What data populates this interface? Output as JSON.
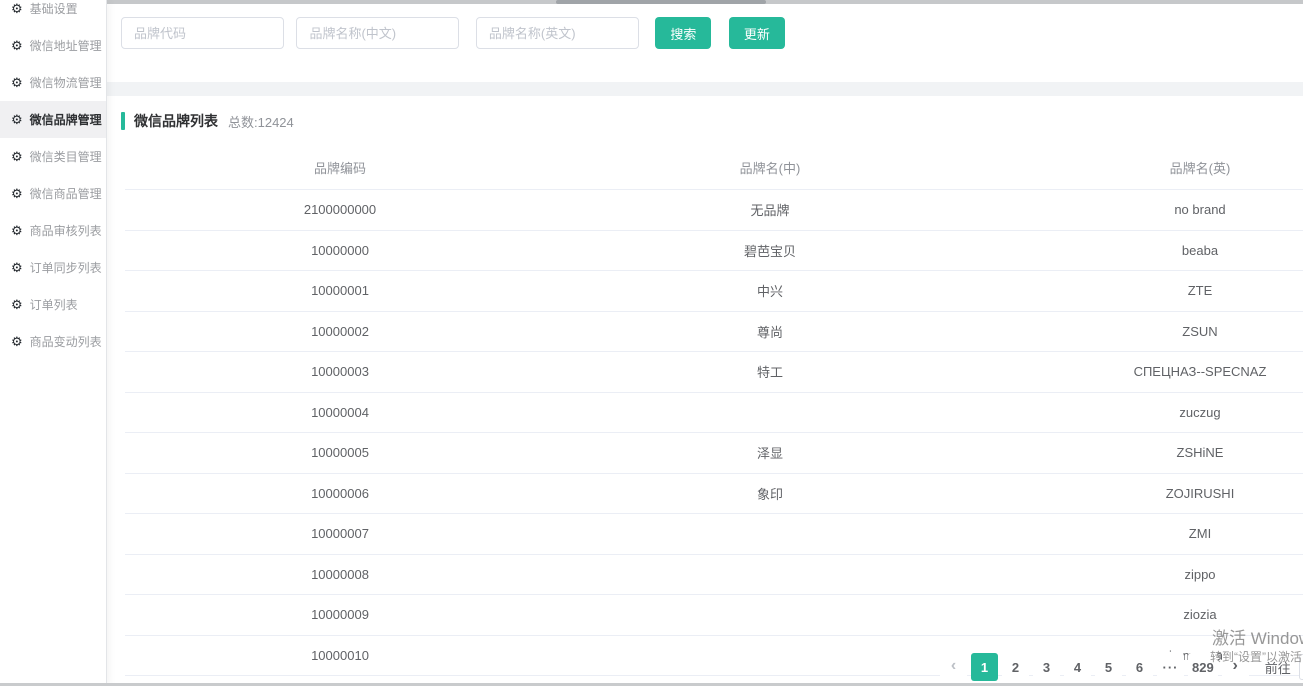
{
  "sidebar": {
    "items": [
      {
        "label": "基础设置",
        "icon": "gear",
        "active": false
      },
      {
        "label": "微信地址管理",
        "icon": "gear",
        "active": false
      },
      {
        "label": "微信物流管理",
        "icon": "gear",
        "active": false
      },
      {
        "label": "微信品牌管理",
        "icon": "gear",
        "active": true
      },
      {
        "label": "微信类目管理",
        "icon": "gear",
        "active": false
      },
      {
        "label": "微信商品管理",
        "icon": "gear",
        "active": false
      },
      {
        "label": "商品审核列表",
        "icon": "gear",
        "active": false
      },
      {
        "label": "订单同步列表",
        "icon": "gear",
        "active": false
      },
      {
        "label": "订单列表",
        "icon": "gear",
        "active": false
      },
      {
        "label": "商品变动列表",
        "icon": "gear",
        "active": false
      }
    ]
  },
  "search": {
    "inputs": [
      {
        "placeholder": "品牌代码",
        "value": ""
      },
      {
        "placeholder": "品牌名称(中文)",
        "value": ""
      },
      {
        "placeholder": "品牌名称(英文)",
        "value": ""
      }
    ],
    "buttons": [
      {
        "label": "搜索"
      },
      {
        "label": "更新"
      }
    ]
  },
  "panel": {
    "title": "微信品牌列表",
    "total": "总数:12424"
  },
  "table": {
    "columns": [
      "品牌编码",
      "品牌名(中)",
      "品牌名(英)"
    ],
    "rows": [
      [
        "2100000000",
        "无品牌",
        "no brand"
      ],
      [
        "10000000",
        "碧芭宝贝",
        "beaba"
      ],
      [
        "10000001",
        "中兴",
        "ZTE"
      ],
      [
        "10000002",
        "尊尚",
        "ZSUN"
      ],
      [
        "10000003",
        "特工",
        "СПЕЦНАЗ--SPECNAZ"
      ],
      [
        "10000004",
        "",
        "zuczug"
      ],
      [
        "10000005",
        "泽显",
        "ZSHiNE"
      ],
      [
        "10000006",
        "象印",
        "ZOJIRUSHI"
      ],
      [
        "10000007",
        "",
        "ZMI"
      ],
      [
        "10000008",
        "",
        "zippo"
      ],
      [
        "10000009",
        "",
        "ziozia"
      ],
      [
        "10000010",
        "",
        "zimmermann"
      ]
    ]
  },
  "pagination": {
    "prev_icon": "‹",
    "next_icon": "›",
    "pages": [
      "1",
      "2",
      "3",
      "4",
      "5",
      "6",
      "···",
      "829"
    ],
    "active_page": "1",
    "goto_label": "前往",
    "goto_value": ""
  },
  "watermark": {
    "line1": "激活 Windows",
    "line2": "转到“设置”以激活 Windows。"
  },
  "colors": {
    "accent": "#26b99a",
    "sidebar_active_bg": "#f0f0f2",
    "table_border": "#ebeef5"
  }
}
